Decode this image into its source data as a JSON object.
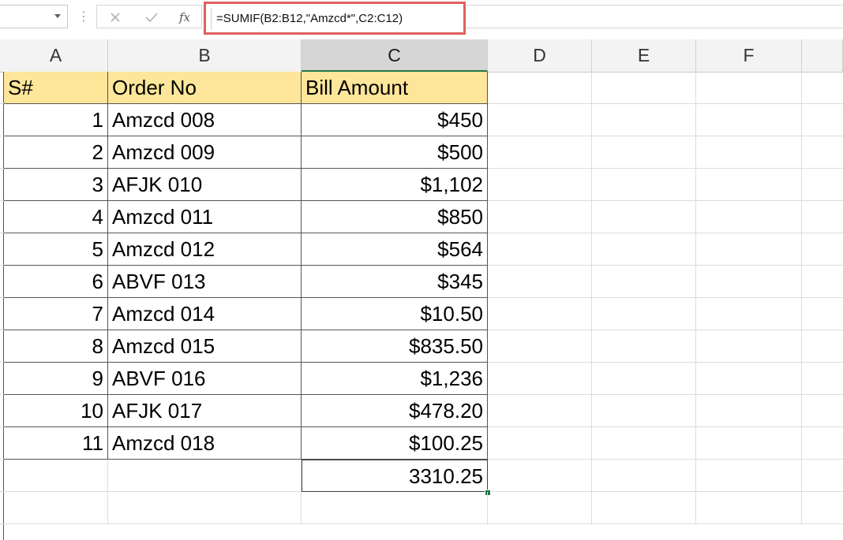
{
  "formula_bar": {
    "name_box_value": "",
    "separator": "⋮",
    "cancel_symbol": "✕",
    "enter_symbol": "✓",
    "insert_function_label": "fx",
    "formula": "=SUMIF(B2:B12,\"Amzcd*\",C2:C12)",
    "highlight_color": "#e0605e"
  },
  "columns": [
    "A",
    "B",
    "C",
    "D",
    "E",
    "F"
  ],
  "selected_column": "C",
  "header_row": {
    "a": "S#",
    "b": "Order No",
    "c": "Bill Amount",
    "fill_color": "#fde69a"
  },
  "rows": [
    {
      "a": "1",
      "b": "Amzcd 008",
      "c": "$450"
    },
    {
      "a": "2",
      "b": "Amzcd 009",
      "c": "$500"
    },
    {
      "a": "3",
      "b": "AFJK 010",
      "c": "$1,102"
    },
    {
      "a": "4",
      "b": "Amzcd 011",
      "c": "$850"
    },
    {
      "a": "5",
      "b": "Amzcd 012",
      "c": "$564"
    },
    {
      "a": "6",
      "b": "ABVF 013",
      "c": "$345"
    },
    {
      "a": "7",
      "b": "Amzcd 014",
      "c": "$10.50"
    },
    {
      "a": "8",
      "b": "Amzcd 015",
      "c": "$835.50"
    },
    {
      "a": "9",
      "b": "ABVF 016",
      "c": "$1,236"
    },
    {
      "a": "10",
      "b": "AFJK 017",
      "c": "$478.20"
    },
    {
      "a": "11",
      "b": "Amzcd 018",
      "c": "$100.25"
    }
  ],
  "total_row": {
    "a": "",
    "b": "",
    "c": "3310.25"
  },
  "selection_color": "#217346"
}
